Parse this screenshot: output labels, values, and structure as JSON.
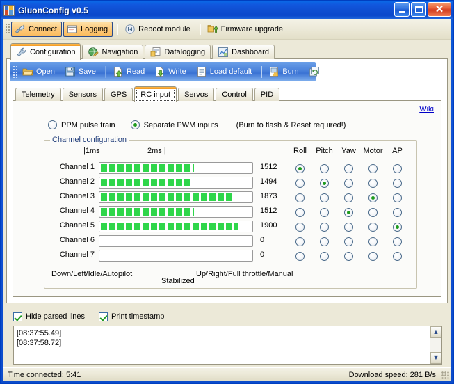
{
  "window": {
    "title": "GluonConfig v0.5",
    "icon": "app-icon",
    "buttons": {
      "minimize": "–",
      "maximize": "□",
      "close": "✕"
    }
  },
  "main_toolbar": {
    "items": [
      {
        "label": "Connect",
        "icon": "connect-plug-icon",
        "checked": true
      },
      {
        "label": "Logging",
        "icon": "logging-window-icon",
        "checked": true
      },
      {
        "label": "Reboot module",
        "icon": "reboot-icon",
        "checked": false
      },
      {
        "label": "Firmware upgrade",
        "icon": "firmware-upgrade-icon",
        "checked": false
      }
    ]
  },
  "outer_tabs": [
    {
      "label": "Configuration",
      "icon": "wrench-icon",
      "active": true
    },
    {
      "label": "Navigation",
      "icon": "globe-pencil-icon",
      "active": false
    },
    {
      "label": "Datalogging",
      "icon": "datalog-icon",
      "active": false
    },
    {
      "label": "Dashboard",
      "icon": "dashboard-icon",
      "active": false
    }
  ],
  "config_toolbar": {
    "items": [
      {
        "label": "Open",
        "icon": "open-folder-icon"
      },
      {
        "label": "Save",
        "icon": "floppy-disk-icon"
      },
      {
        "label": "Read",
        "icon": "read-page-icon"
      },
      {
        "label": "Write",
        "icon": "write-page-icon"
      },
      {
        "label": "Load default",
        "icon": "load-default-icon"
      },
      {
        "label": "Burn",
        "icon": "burn-icon"
      },
      {
        "label": "Reload",
        "icon": "reload-icon"
      }
    ]
  },
  "inner_tabs": [
    {
      "label": "Telemetry",
      "active": false
    },
    {
      "label": "Sensors",
      "active": false
    },
    {
      "label": "GPS",
      "active": false
    },
    {
      "label": "RC input",
      "active": true
    },
    {
      "label": "Servos",
      "active": false
    },
    {
      "label": "Control",
      "active": false
    },
    {
      "label": "PID",
      "active": false
    }
  ],
  "rc_input": {
    "wiki_link": "Wiki",
    "mode_options": [
      {
        "label": "PPM pulse train",
        "selected": false
      },
      {
        "label": "Separate PWM inputs",
        "selected": true
      }
    ],
    "burn_note": "(Burn to flash & Reset required!)",
    "group_title": "Channel configuration",
    "scale": {
      "left": "|1ms",
      "right": "2ms |"
    },
    "function_columns": [
      "Roll",
      "Pitch",
      "Yaw",
      "Motor",
      "AP"
    ],
    "channels": [
      {
        "name": "Channel 1",
        "value": "1512",
        "pct": 62,
        "assigned": "Roll"
      },
      {
        "name": "Channel 2",
        "value": "1494",
        "pct": 61,
        "assigned": "Pitch"
      },
      {
        "name": "Channel 3",
        "value": "1873",
        "pct": 87,
        "assigned": "Motor"
      },
      {
        "name": "Channel 4",
        "value": "1512",
        "pct": 62,
        "assigned": "Yaw"
      },
      {
        "name": "Channel 5",
        "value": "1900",
        "pct": 91,
        "assigned": "AP"
      },
      {
        "name": "Channel 6",
        "value": "0",
        "pct": 0,
        "assigned": ""
      },
      {
        "name": "Channel 7",
        "value": "0",
        "pct": 0,
        "assigned": ""
      }
    ],
    "footnotes": {
      "left": "Down/Left/Idle/Autopilot",
      "middle": "Stabilized",
      "right": "Up/Right/Full throttle/Manual"
    }
  },
  "log_panel": {
    "checkboxes": [
      {
        "label": "Hide parsed lines",
        "checked": true
      },
      {
        "label": "Print timestamp",
        "checked": true
      }
    ],
    "lines": "[08:37:55.49]\n[08:37:58.72]",
    "scroll_up_icon": "chevron-up-icon",
    "scroll_down_icon": "chevron-down-icon"
  },
  "status_bar": {
    "left": "Time connected:  5:41",
    "right": "Download speed:  281 B/s"
  },
  "colors": {
    "title_blue": "#0f4fd2",
    "bar_green": "#2fd64a",
    "link_blue": "#0000c8",
    "toolbar_blue": "#4f86dd",
    "tab_orange": "#f29a22",
    "face": "#ece9d8"
  }
}
